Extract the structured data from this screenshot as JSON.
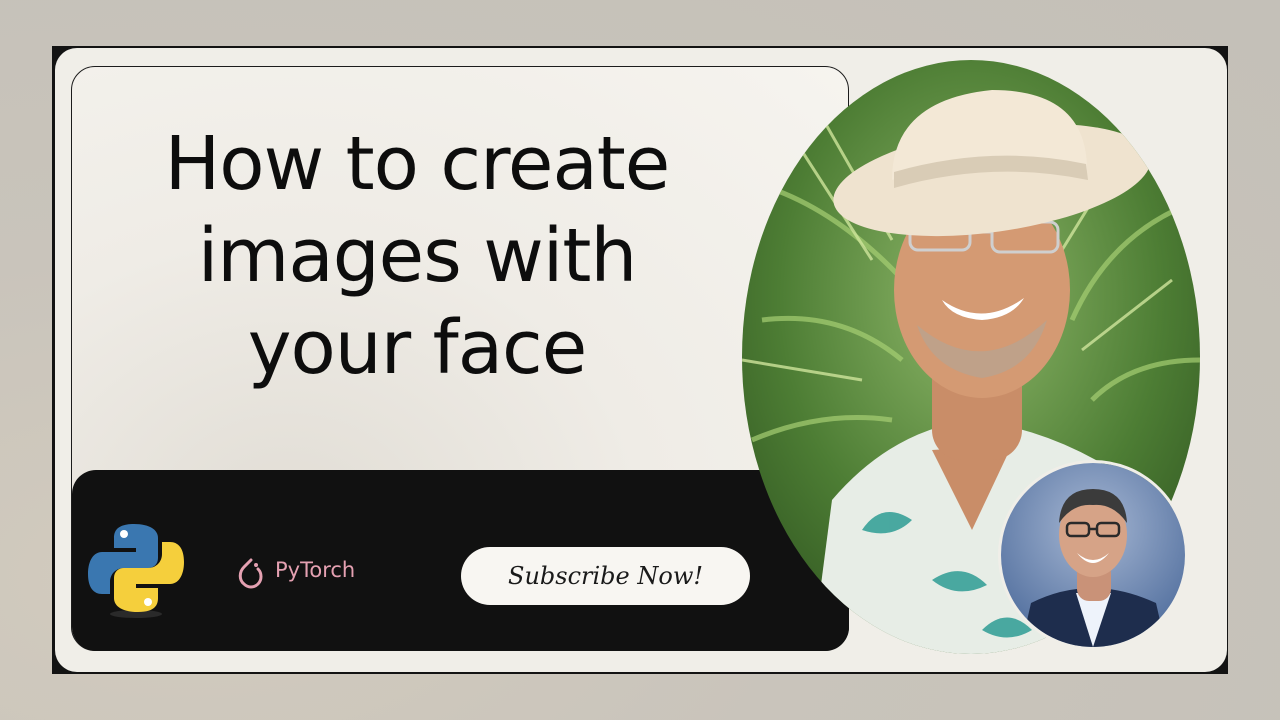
{
  "thumbnail": {
    "title": "How to create\nimages with\nyour face",
    "subscribe_label": "Subscribe Now!",
    "pytorch_label": "PyTorch"
  },
  "logos": {
    "python_icon": "python-logo-icon",
    "pytorch_icon": "pytorch-flame-icon"
  },
  "colors": {
    "frame": "#131313",
    "card": "#f0eee8",
    "footer": "#111111",
    "python_blue": "#3a77b0",
    "python_yellow": "#f5cf3c",
    "pytorch_pink": "#e5a1b2",
    "button_bg": "#f8f6f2"
  }
}
